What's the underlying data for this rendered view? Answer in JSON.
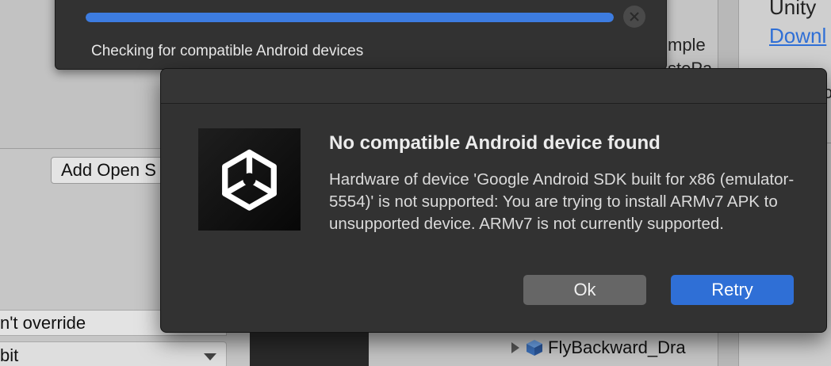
{
  "background": {
    "add_open_button": "Add Open S",
    "override_value": "n't override",
    "bit_dropdown_value": "bit",
    "unity_label": "Unity",
    "download_link": "Downl",
    "cut_text_1": "mple",
    "cut_text_2": "stePa",
    "right_fragment_1": "o",
    "right_fragment_2": "",
    "asset_item": "FlyBackward_Dra"
  },
  "progress": {
    "status": "Checking for compatible Android devices",
    "fraction": 1.0,
    "accent_color": "#3d7ce0"
  },
  "dialog": {
    "title": "No compatible Android device found",
    "body": "Hardware of device 'Google Android SDK built for x86 (emulator-5554)' is not supported: You are trying to install ARMv7 APK to unsupported device. ARMv7 is not currently supported.",
    "ok_label": "Ok",
    "retry_label": "Retry",
    "logo_icon": "unity-logo-icon",
    "primary_color": "#2f6fd6"
  }
}
